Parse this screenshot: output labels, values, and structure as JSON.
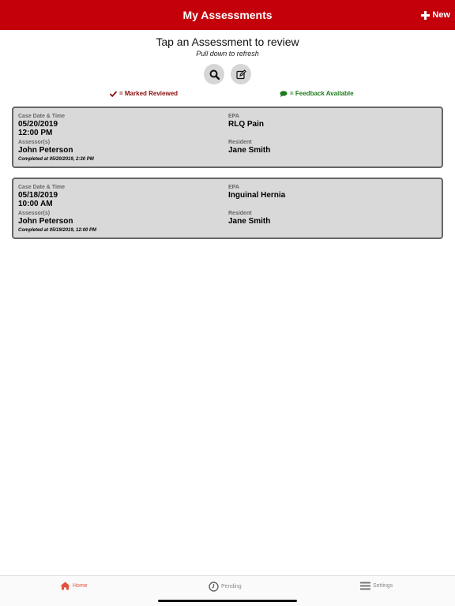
{
  "header": {
    "title": "My Assessments",
    "new_label": "New",
    "bg_color": "#c4000b"
  },
  "intro": {
    "prompt": "Tap an Assessment to review",
    "sub_prompt": "Pull down to refresh"
  },
  "toolbar": {
    "search_icon": "search-icon",
    "edit_icon": "edit-icon"
  },
  "legend": {
    "reviewed": "= Marked Reviewed",
    "reviewed_color": "#8b0b0b",
    "feedback": "= Feedback Available",
    "feedback_color": "#1d7a1d"
  },
  "assessments": [
    {
      "case_label": "Case Date & Time",
      "case_date": "05/20/2019",
      "case_time": "12:00 PM",
      "epa_label": "EPA",
      "epa": "RLQ Pain",
      "assessor_label": "Assessor(s)",
      "assessor": "John Peterson",
      "resident_label": "Resident",
      "resident": "Jane Smith",
      "completed": "Completed at 05/20/2019, 2:30 PM"
    },
    {
      "case_label": "Case Date & Time",
      "case_date": "05/18/2019",
      "case_time": "10:00 AM",
      "epa_label": "EPA",
      "epa": "Inguinal Hernia",
      "assessor_label": "Assessor(s)",
      "assessor": "John Peterson",
      "resident_label": "Resident",
      "resident": "Jane Smith",
      "completed": "Completed at 05/19/2019, 12:00 PM"
    }
  ],
  "tabs": [
    {
      "label": "Home",
      "icon": "home-icon",
      "active": true
    },
    {
      "label": "Pending",
      "icon": "clock-icon",
      "active": false
    },
    {
      "label": "Settings",
      "icon": "menu-icon",
      "active": false
    }
  ]
}
